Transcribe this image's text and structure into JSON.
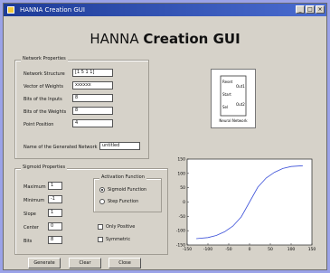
{
  "window": {
    "title": "HANNA Creation GUI",
    "controls": [
      "_",
      "□",
      "×"
    ]
  },
  "header": {
    "title_plain": "HANNA ",
    "title_bold": "Creation GUI"
  },
  "network_properties": {
    "title": "Network Properties",
    "fields": [
      {
        "label": "Network Structure",
        "value": "[1 5 1 1]"
      },
      {
        "label": "Vector of Weights",
        "value": "xxxxxx"
      },
      {
        "label": "Bits of the Inputs",
        "value": "8"
      },
      {
        "label": "Bits of the Weights",
        "value": "8"
      },
      {
        "label": "Point Position",
        "value": "4"
      }
    ],
    "generated_name_label": "Name of the Generated Network",
    "generated_name_value": "untitled"
  },
  "sigmoid_properties": {
    "title": "Sigmoid Properties",
    "fields": [
      {
        "label": "Maximum",
        "value": "1"
      },
      {
        "label": "Minimum",
        "value": "-1"
      },
      {
        "label": "Slope",
        "value": "1"
      },
      {
        "label": "Center",
        "value": "0"
      },
      {
        "label": "Bits",
        "value": "8"
      }
    ],
    "activation_title": "Activation Function",
    "options": [
      {
        "label": "Sigmoid Function",
        "checked": true
      },
      {
        "label": "Step Function",
        "checked": false
      }
    ],
    "checkboxes": [
      {
        "label": "Only Positive",
        "checked": false
      },
      {
        "label": "Symmetric",
        "checked": false
      }
    ]
  },
  "buttons": {
    "generate": "Generate",
    "clear": "Clear",
    "close": "Close"
  },
  "block_diagram": {
    "inputs": [
      "Reset",
      "Start",
      "Sel"
    ],
    "outputs": [
      "Out1",
      "Out2"
    ],
    "caption": "Neural Network"
  },
  "chart_data": {
    "type": "line",
    "x_ticks": [
      "-150",
      "-100",
      "-50",
      "0",
      "50",
      "100",
      "150"
    ],
    "y_ticks": [
      "150",
      "100",
      "50",
      "0",
      "-50",
      "-100",
      "-150"
    ],
    "xlim": [
      -150,
      150
    ],
    "ylim": [
      -150,
      150
    ],
    "series": [
      {
        "color": "#3a4fd8",
        "x": [
          -128,
          -100,
          -80,
          -60,
          -40,
          -20,
          0,
          20,
          40,
          60,
          80,
          100,
          128
        ],
        "y": [
          -128,
          -124,
          -117,
          -104,
          -84,
          -52,
          0,
          52,
          84,
          104,
          117,
          124,
          127
        ]
      }
    ]
  }
}
